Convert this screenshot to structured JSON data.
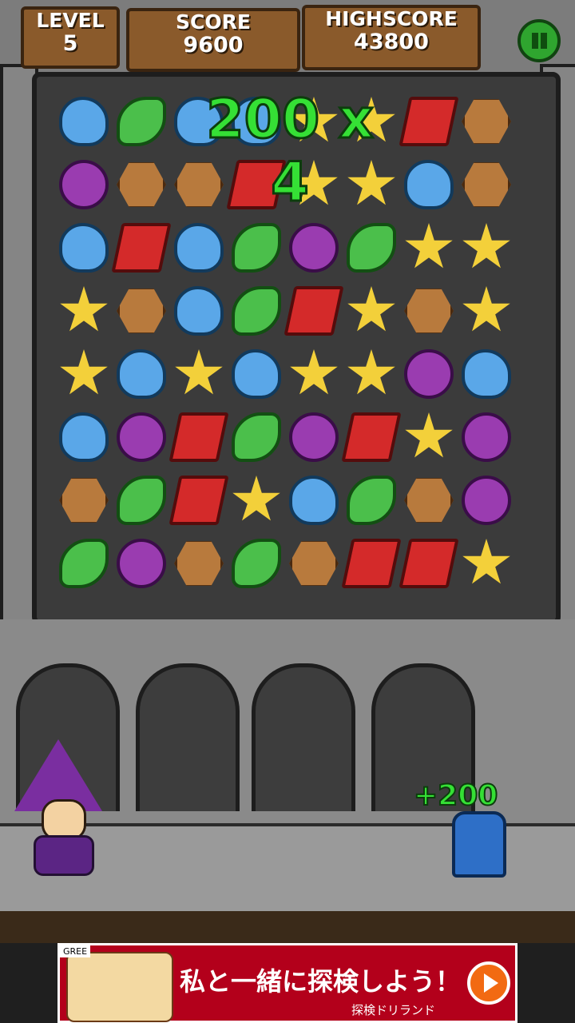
{
  "hud": {
    "level_label": "LEVEL",
    "level_value": "5",
    "score_label": "SCORE",
    "score_value": "9600",
    "highscore_label": "HIGHSCORE",
    "highscore_value": "43800",
    "pause_icon": "pause-icon"
  },
  "combo_text": "200 x 4",
  "popup_text": "+200",
  "board": {
    "rows": [
      [
        "blue",
        "green",
        "blue",
        "blue",
        "star",
        "star",
        "red",
        "brown"
      ],
      [
        "purple",
        "brown",
        "brown",
        "red",
        "star",
        "star",
        "blue",
        "brown"
      ],
      [
        "blue",
        "red",
        "blue",
        "green",
        "purple",
        "green",
        "star",
        "star"
      ],
      [
        "star",
        "brown",
        "blue",
        "green",
        "red",
        "star",
        "brown",
        "star"
      ],
      [
        "star",
        "blue",
        "star",
        "blue",
        "star",
        "star",
        "purple",
        "blue"
      ],
      [
        "blue",
        "purple",
        "red",
        "green",
        "purple",
        "red",
        "star",
        "purple"
      ],
      [
        "brown",
        "green",
        "red",
        "star",
        "blue",
        "green",
        "brown",
        "purple"
      ],
      [
        "green",
        "purple",
        "brown",
        "green",
        "brown",
        "red",
        "red",
        "star"
      ]
    ]
  },
  "ad": {
    "badge": "GREE",
    "headline": "私と一緒に探検しよう！",
    "subtext": "探検ドリランド",
    "button_icon": "play-icon"
  },
  "colors": {
    "accent_green": "#35e035",
    "plank": "#8a5a2b",
    "ad_red": "#b3001b"
  }
}
